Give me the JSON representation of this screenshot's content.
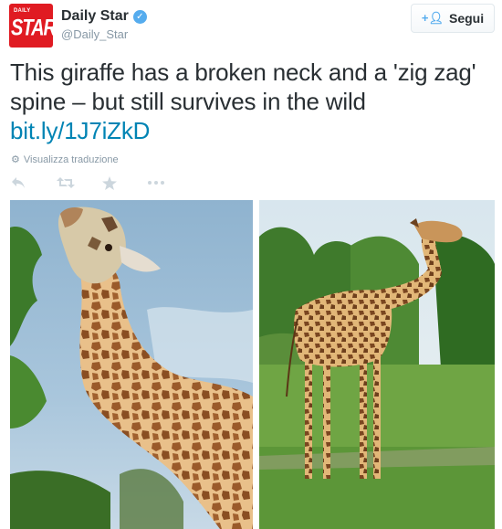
{
  "account": {
    "avatar_text_top": "DAILY",
    "avatar_text_main": "STAR",
    "display_name": "Daily Star",
    "verified_icon": "verified-badge-icon",
    "handle": "@Daily_Star"
  },
  "follow_button": {
    "icon": "follow-user-icon",
    "label": "Segui"
  },
  "tweet": {
    "text": "This giraffe has a broken neck and a 'zig zag' spine – but still survives in the wild",
    "link": "bit.ly/1J7iZkD",
    "translate_label": "Visualizza traduzione",
    "translate_icon": "globe-icon"
  },
  "actions": [
    {
      "name": "reply",
      "icon": "reply-icon"
    },
    {
      "name": "retweet",
      "icon": "retweet-icon"
    },
    {
      "name": "favorite",
      "icon": "star-icon"
    },
    {
      "name": "more",
      "icon": "more-icon"
    }
  ],
  "photos": [
    {
      "name": "giraffe-closeup-photo"
    },
    {
      "name": "giraffe-field-photo"
    }
  ],
  "colors": {
    "brand_red": "#e01b22",
    "link_blue": "#0084b4",
    "verified_blue": "#55acee",
    "text_dark": "#292f33",
    "text_muted": "#8899a6"
  }
}
